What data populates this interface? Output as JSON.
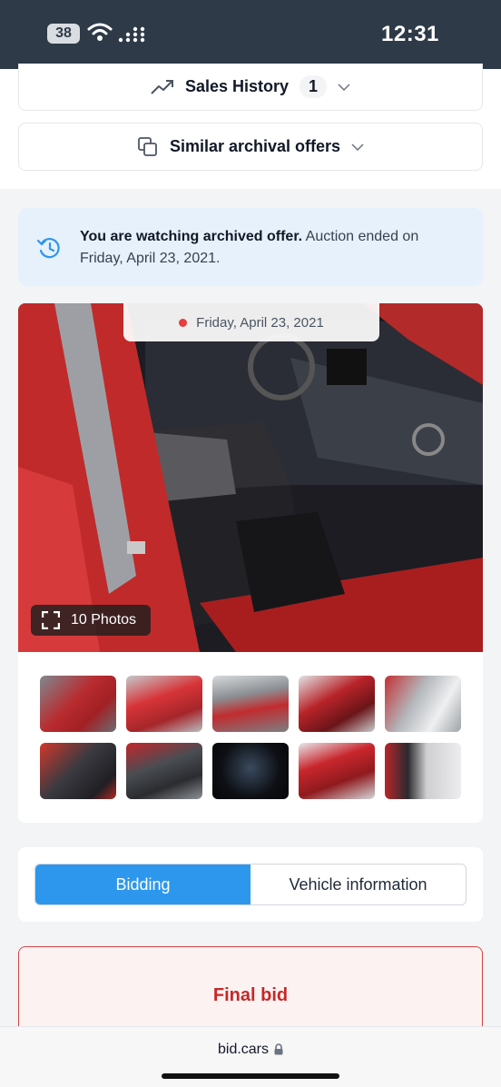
{
  "status_bar": {
    "battery": "38",
    "time": "12:31"
  },
  "sales_history": {
    "label": "Sales History",
    "count": "1",
    "icon": "trend-up-icon"
  },
  "similar_offers": {
    "label": "Similar archival offers",
    "icon": "copy-icon"
  },
  "notice": {
    "bold": "You are watching archived offer.",
    "text": " Auction ended on Friday, April 23, 2021.",
    "icon": "history-icon"
  },
  "gallery": {
    "date": "Friday, April 23, 2021",
    "photos_label": "10 Photos"
  },
  "tabs": [
    {
      "label": "Bidding",
      "active": true
    },
    {
      "label": "Vehicle information",
      "active": false
    }
  ],
  "final_bid": {
    "title": "Final bid"
  },
  "browser": {
    "url": "bid.cars"
  },
  "colors": {
    "status_bar": "#2f3a48",
    "accent_blue": "#2d97ee",
    "notice_bg": "#e6f1fb",
    "final_bid_red": "#c62828"
  }
}
